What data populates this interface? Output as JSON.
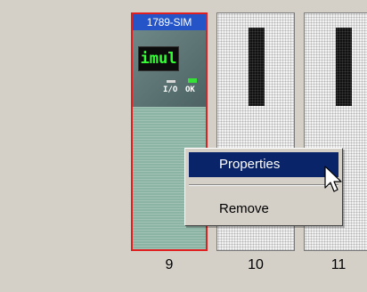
{
  "module": {
    "title": "1789-SIM",
    "display_text": "imul",
    "io_label": "I/O",
    "ok_label": "OK"
  },
  "slots": [
    {
      "number": "9"
    },
    {
      "number": "10"
    },
    {
      "number": "11"
    }
  ],
  "context_menu": {
    "items": [
      {
        "label": "Properties"
      },
      {
        "label": "Remove"
      }
    ]
  },
  "colors": {
    "selection": "#0a246a",
    "module_border": "#e02020",
    "title_bar": "#2454c8",
    "display_text": "#35ff35"
  }
}
